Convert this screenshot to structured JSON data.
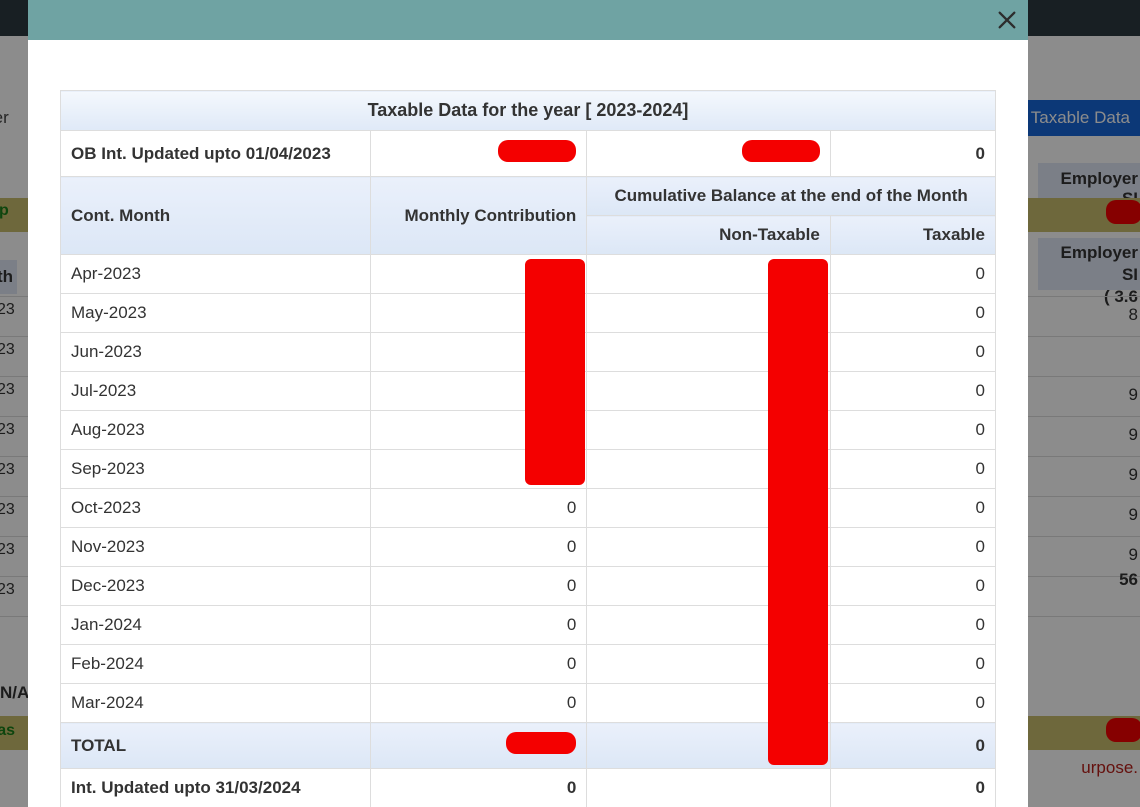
{
  "bg": {
    "member_label": "mber",
    "taxable_button": "Taxable Data",
    "employer_sh": "Employer SI",
    "employer_sh2_line1": "Employer SI",
    "employer_sh2_line2": "( 3.6",
    "green_updated": "d up",
    "th_left": "th",
    "right_vals": [
      "8",
      "9",
      "9",
      "9",
      "9",
      "9",
      "56"
    ],
    "years_left": [
      "23",
      "23",
      "23",
      "23",
      "23",
      "23",
      "23",
      "23"
    ],
    "na": "N/A",
    "balance_as": "ce as",
    "purpose": "urpose."
  },
  "modal": {
    "title": "Taxable Data for the year [ 2023-2024]",
    "ob_label": "OB Int. Updated upto 01/04/2023",
    "ob_taxable": "0",
    "headers": {
      "cont_month": "Cont. Month",
      "monthly_contribution": "Monthly Contribution",
      "cumulative": "Cumulative Balance at the end of the Month",
      "non_taxable": "Non-Taxable",
      "taxable": "Taxable"
    },
    "rows": [
      {
        "month": "Apr-2023",
        "mc": "",
        "nt": "",
        "tx": "0"
      },
      {
        "month": "May-2023",
        "mc": "",
        "nt": "",
        "tx": "0"
      },
      {
        "month": "Jun-2023",
        "mc": "",
        "nt": "",
        "tx": "0"
      },
      {
        "month": "Jul-2023",
        "mc": "",
        "nt": "",
        "tx": "0"
      },
      {
        "month": "Aug-2023",
        "mc": "",
        "nt": "",
        "tx": "0"
      },
      {
        "month": "Sep-2023",
        "mc": "",
        "nt": "",
        "tx": "0"
      },
      {
        "month": "Oct-2023",
        "mc": "0",
        "nt": "",
        "tx": "0"
      },
      {
        "month": "Nov-2023",
        "mc": "0",
        "nt": "",
        "tx": "0"
      },
      {
        "month": "Dec-2023",
        "mc": "0",
        "nt": "",
        "tx": "0"
      },
      {
        "month": "Jan-2024",
        "mc": "0",
        "nt": "",
        "tx": "0"
      },
      {
        "month": "Feb-2024",
        "mc": "0",
        "nt": "",
        "tx": "0"
      },
      {
        "month": "Mar-2024",
        "mc": "0",
        "nt": "",
        "tx": "0"
      }
    ],
    "total_label": "TOTAL",
    "total_tx": "0",
    "int_label": "Int. Updated upto 31/03/2024",
    "int_mc": "0",
    "int_tx": "0"
  }
}
